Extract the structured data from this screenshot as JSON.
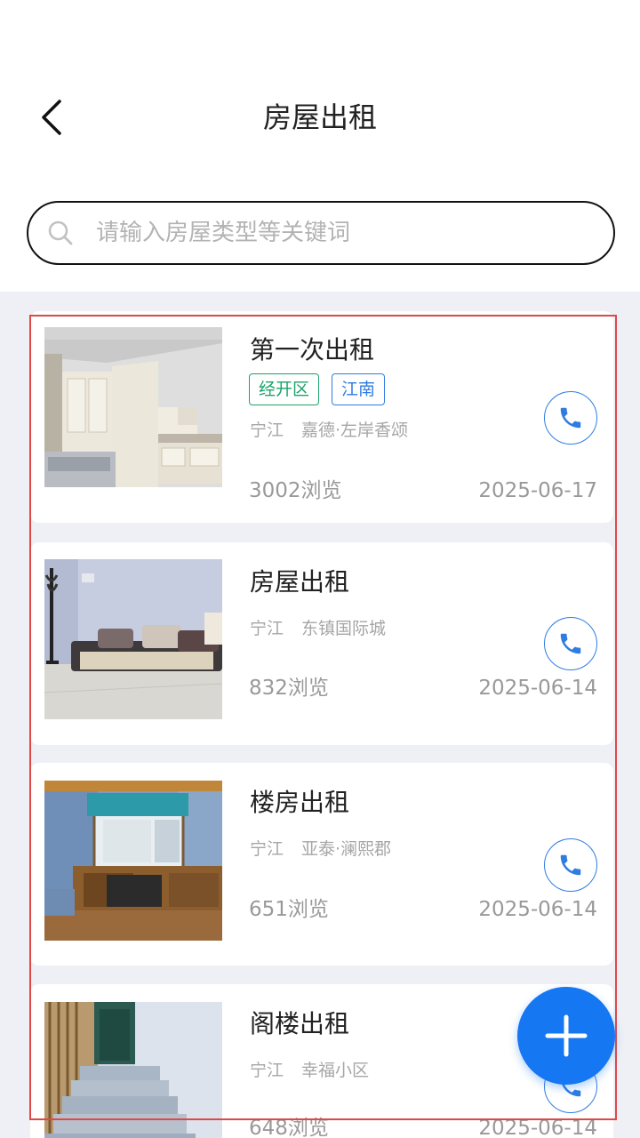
{
  "header": {
    "title": "房屋出租"
  },
  "search": {
    "placeholder": "请输入房屋类型等关键词",
    "value": ""
  },
  "listings": [
    {
      "title": "第一次出租",
      "tags": [
        "经开区",
        "江南"
      ],
      "city": "宁江",
      "community": "嘉德·左岸香颂",
      "views": "3002浏览",
      "date": "2025-06-17"
    },
    {
      "title": "房屋出租",
      "tags": [],
      "city": "宁江",
      "community": "东镇国际城",
      "views": "832浏览",
      "date": "2025-06-14"
    },
    {
      "title": "楼房出租",
      "tags": [],
      "city": "宁江",
      "community": "亚泰·澜熙郡",
      "views": "651浏览",
      "date": "2025-06-14"
    },
    {
      "title": "阁楼出租",
      "tags": [],
      "city": "宁江",
      "community": "幸福小区",
      "views": "648浏览",
      "date": "2025-06-14"
    }
  ],
  "colors": {
    "accent": "#1677f2",
    "tag_green": "#1aa36a",
    "tag_blue": "#2f7de1",
    "list_background": "#eef0f5",
    "highlight_border": "#e04848"
  },
  "icons": {
    "back": "chevron-left-icon",
    "search": "search-icon",
    "call": "phone-icon",
    "add": "plus-icon"
  }
}
